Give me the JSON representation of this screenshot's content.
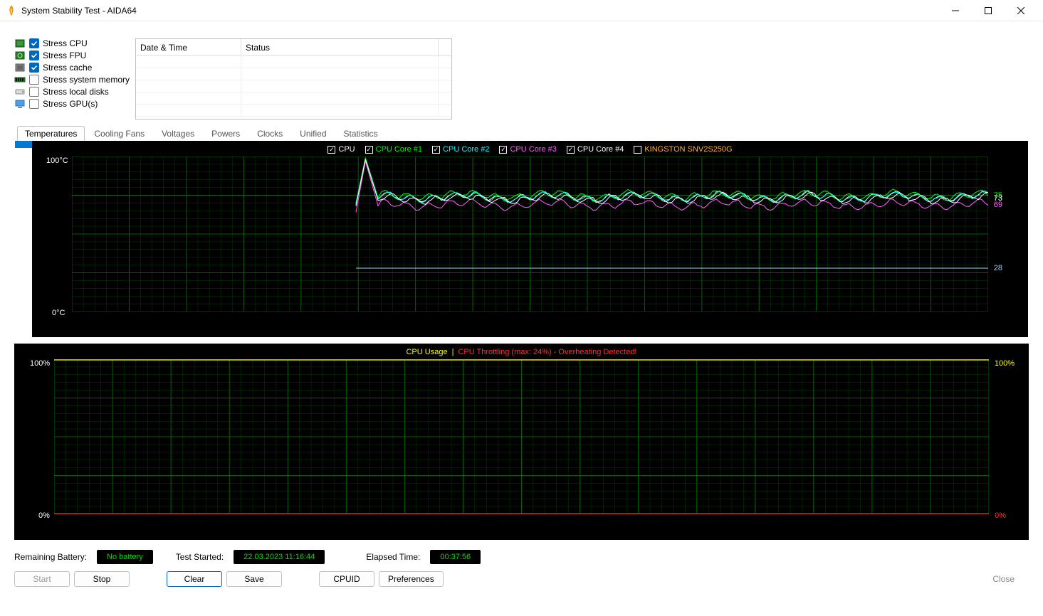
{
  "window": {
    "title": "System Stability Test - AIDA64"
  },
  "stress_options": [
    {
      "label": "Stress CPU",
      "checked": true
    },
    {
      "label": "Stress FPU",
      "checked": true
    },
    {
      "label": "Stress cache",
      "checked": true
    },
    {
      "label": "Stress system memory",
      "checked": false
    },
    {
      "label": "Stress local disks",
      "checked": false
    },
    {
      "label": "Stress GPU(s)",
      "checked": false
    }
  ],
  "log_columns": {
    "date": "Date & Time",
    "status": "Status"
  },
  "tabs": [
    "Temperatures",
    "Cooling Fans",
    "Voltages",
    "Powers",
    "Clocks",
    "Unified",
    "Statistics"
  ],
  "active_tab": "Temperatures",
  "temp_chart": {
    "y_max_label": "100°C",
    "y_min_label": "0°C",
    "legend": [
      {
        "label": "CPU",
        "color": "#ffffff",
        "checked": true
      },
      {
        "label": "CPU Core #1",
        "color": "#00ff00",
        "checked": true
      },
      {
        "label": "CPU Core #2",
        "color": "#00ffff",
        "checked": true
      },
      {
        "label": "CPU Core #3",
        "color": "#ff60ff",
        "checked": true
      },
      {
        "label": "CPU Core #4",
        "color": "#ffffff",
        "checked": true
      },
      {
        "label": "KINGSTON SNV2S250G",
        "color": "#ffb040",
        "checked": false
      }
    ],
    "right_labels": [
      {
        "text": "75",
        "color": "#00ff00",
        "value": 75
      },
      {
        "text": "73",
        "color": "#ffffff",
        "value": 73
      },
      {
        "text": "69",
        "color": "#ff60ff",
        "value": 69
      },
      {
        "text": "28",
        "color": "#9acfff",
        "value": 28
      }
    ]
  },
  "usage_chart": {
    "y_max_label": "100%",
    "y_min_label": "0%",
    "right_max": "100%",
    "right_min": "0%",
    "legend": {
      "cpu_usage": "CPU Usage",
      "sep": "|",
      "throttle": "CPU Throttling (max: 24%) - Overheating Detected!"
    }
  },
  "status": {
    "battery_label": "Remaining Battery:",
    "battery_value": "No battery",
    "started_label": "Test Started:",
    "started_value": "22.03.2023 11:16:44",
    "elapsed_label": "Elapsed Time:",
    "elapsed_value": "00:37:56"
  },
  "buttons": {
    "start": "Start",
    "stop": "Stop",
    "clear": "Clear",
    "save": "Save",
    "cpuid": "CPUID",
    "prefs": "Preferences",
    "close": "Close"
  },
  "chart_data": {
    "type": "line",
    "title": "Temperatures",
    "ylabel": "°C",
    "ylim": [
      0,
      100
    ],
    "x_fraction_range": [
      0,
      1
    ],
    "series": [
      {
        "name": "CPU",
        "color": "#ffffff",
        "approx_steady": 74,
        "peak": 99,
        "spike_at_x": 0.31
      },
      {
        "name": "CPU Core #1",
        "color": "#00ff00",
        "approx_steady": 75,
        "peak": 99,
        "spike_at_x": 0.31
      },
      {
        "name": "CPU Core #2",
        "color": "#00ffff",
        "approx_steady": 74,
        "peak": 98,
        "spike_at_x": 0.31
      },
      {
        "name": "CPU Core #3",
        "color": "#ff60ff",
        "approx_steady": 69,
        "peak": 97,
        "spike_at_x": 0.31
      },
      {
        "name": "CPU Core #4",
        "color": "#ffffff",
        "approx_steady": 73,
        "peak": 98,
        "spike_at_x": 0.31
      },
      {
        "name": "KINGSTON SNV2S250G",
        "color": "#9acfff",
        "approx_steady": 28,
        "peak": 28,
        "flat": true
      }
    ],
    "usage": {
      "type": "line",
      "ylim": [
        0,
        100
      ],
      "series": [
        {
          "name": "CPU Usage",
          "color": "#ffff00",
          "current": 100
        },
        {
          "name": "CPU Throttling",
          "color": "#ff3030",
          "max": 24,
          "current": 0
        }
      ]
    }
  }
}
